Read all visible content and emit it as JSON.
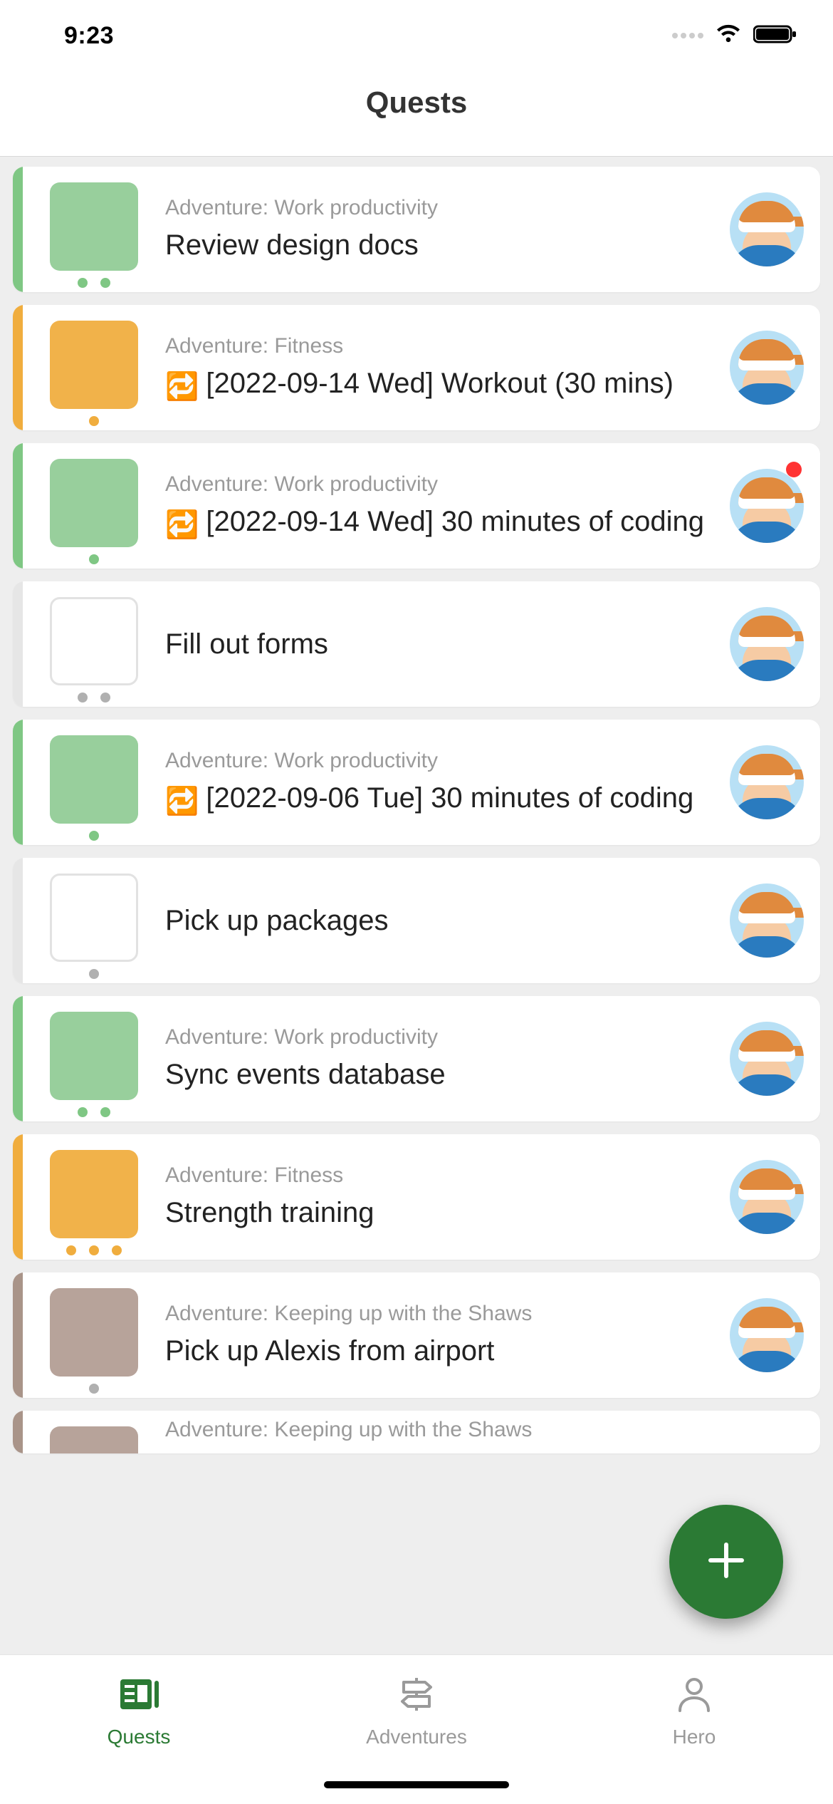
{
  "status": {
    "time": "9:23"
  },
  "header": {
    "title": "Quests"
  },
  "colors": {
    "green": "#98cf9c",
    "green_stripe": "#7fc784",
    "orange": "#f1b24a",
    "orange_stripe": "#f0ad3e",
    "brown": "#b7a39a",
    "brown_stripe": "#a99489",
    "none_stripe": "#e6e6e6",
    "gray_dot": "#b0b0b0",
    "green_dot": "#7fc784",
    "orange_dot": "#f0ad3e"
  },
  "quests": [
    {
      "adventure": "Adventure: Work productivity",
      "title": "Review design docs",
      "repeat": false,
      "thumb": "green",
      "stripe": "green_stripe",
      "dots": [
        "green_dot",
        "green_dot"
      ],
      "badge": false
    },
    {
      "adventure": "Adventure: Fitness",
      "title": "[2022-09-14 Wed] Workout (30 mins)",
      "repeat": true,
      "thumb": "orange",
      "stripe": "orange_stripe",
      "dots": [
        "orange_dot"
      ],
      "badge": false
    },
    {
      "adventure": "Adventure: Work productivity",
      "title": "[2022-09-14 Wed] 30 minutes of coding",
      "repeat": true,
      "thumb": "green",
      "stripe": "green_stripe",
      "dots": [
        "green_dot"
      ],
      "badge": true
    },
    {
      "adventure": "",
      "title": "Fill out forms",
      "repeat": false,
      "thumb": "outline",
      "stripe": "none_stripe",
      "dots": [
        "gray_dot",
        "gray_dot"
      ],
      "badge": false
    },
    {
      "adventure": "Adventure: Work productivity",
      "title": "[2022-09-06 Tue] 30 minutes of coding",
      "repeat": true,
      "thumb": "green",
      "stripe": "green_stripe",
      "dots": [
        "green_dot"
      ],
      "badge": false
    },
    {
      "adventure": "",
      "title": "Pick up packages",
      "repeat": false,
      "thumb": "outline",
      "stripe": "none_stripe",
      "dots": [
        "gray_dot"
      ],
      "badge": false
    },
    {
      "adventure": "Adventure: Work productivity",
      "title": "Sync events database",
      "repeat": false,
      "thumb": "green",
      "stripe": "green_stripe",
      "dots": [
        "green_dot",
        "green_dot"
      ],
      "badge": false
    },
    {
      "adventure": "Adventure: Fitness",
      "title": "Strength training",
      "repeat": false,
      "thumb": "orange",
      "stripe": "orange_stripe",
      "dots": [
        "orange_dot",
        "orange_dot",
        "orange_dot"
      ],
      "badge": false
    },
    {
      "adventure": "Adventure: Keeping up with the Shaws",
      "title": "Pick up Alexis from airport",
      "repeat": false,
      "thumb": "brown",
      "stripe": "brown_stripe",
      "dots": [
        "gray_dot"
      ],
      "badge": false
    },
    {
      "adventure": "Adventure: Keeping up with the Shaws",
      "title": "",
      "repeat": false,
      "thumb": "brown",
      "stripe": "brown_stripe",
      "dots": [],
      "badge": false,
      "partial": true
    }
  ],
  "tabs": {
    "quests": "Quests",
    "adventures": "Adventures",
    "hero": "Hero"
  }
}
